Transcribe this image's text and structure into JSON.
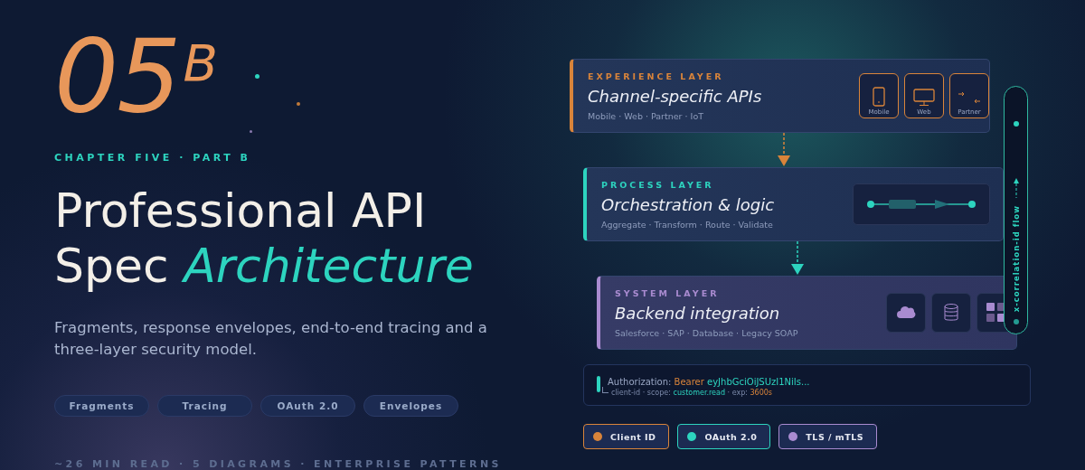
{
  "hero": {
    "chapter_number": "05",
    "chapter_suffix": "B",
    "eyebrow": "CHAPTER FIVE · PART B",
    "title_line_1": "Professional API",
    "title_line_2": "Spec",
    "title_accent": "Architecture",
    "subtitle": "Fragments, response envelopes, end-to-end tracing and a three-layer security model.",
    "tags": [
      "Fragments",
      "Tracing",
      "OAuth 2.0",
      "Envelopes"
    ],
    "meta": "~26 MIN READ · 5 DIAGRAMS · ENTERPRISE PATTERNS"
  },
  "layers": [
    {
      "kind": "experience",
      "color": "#d9843a",
      "label": "EXPERIENCE LAYER",
      "title": "Channel-specific APIs",
      "subtitle": "Mobile · Web · Partner · IoT",
      "tiles": [
        {
          "kind": "phone",
          "label": "Mobile"
        },
        {
          "kind": "monitor",
          "label": "Web"
        },
        {
          "kind": "exchange",
          "label": "Partner"
        }
      ]
    },
    {
      "kind": "process",
      "color": "#2dd4bf",
      "label": "PROCESS LAYER",
      "title": "Orchestration & logic",
      "subtitle": "Aggregate · Transform · Route · Validate",
      "tiles": [
        {
          "kind": "pipeline"
        }
      ]
    },
    {
      "kind": "system",
      "color": "#a98bd0",
      "label": "SYSTEM LAYER",
      "title": "Backend integration",
      "subtitle": "Salesforce · SAP · Database · Legacy SOAP",
      "tiles": [
        {
          "kind": "cloud"
        },
        {
          "kind": "database"
        },
        {
          "kind": "grid"
        }
      ]
    }
  ],
  "flow": {
    "label": "x-correlation-id flow"
  },
  "token": {
    "header": "Authorization:",
    "scheme": "Bearer",
    "value": "eyJhbGciOiJSUzI1NiIs...",
    "detail_1": "client-id · scope:",
    "scope": "customer.read",
    "detail_2": "· exp:",
    "expiry": "3600s"
  },
  "legend": [
    {
      "label": "Client ID",
      "color": "#d9843a"
    },
    {
      "label": "OAuth 2.0",
      "color": "#2dd4bf"
    },
    {
      "label": "TLS / mTLS",
      "color": "#a98bd0"
    }
  ]
}
